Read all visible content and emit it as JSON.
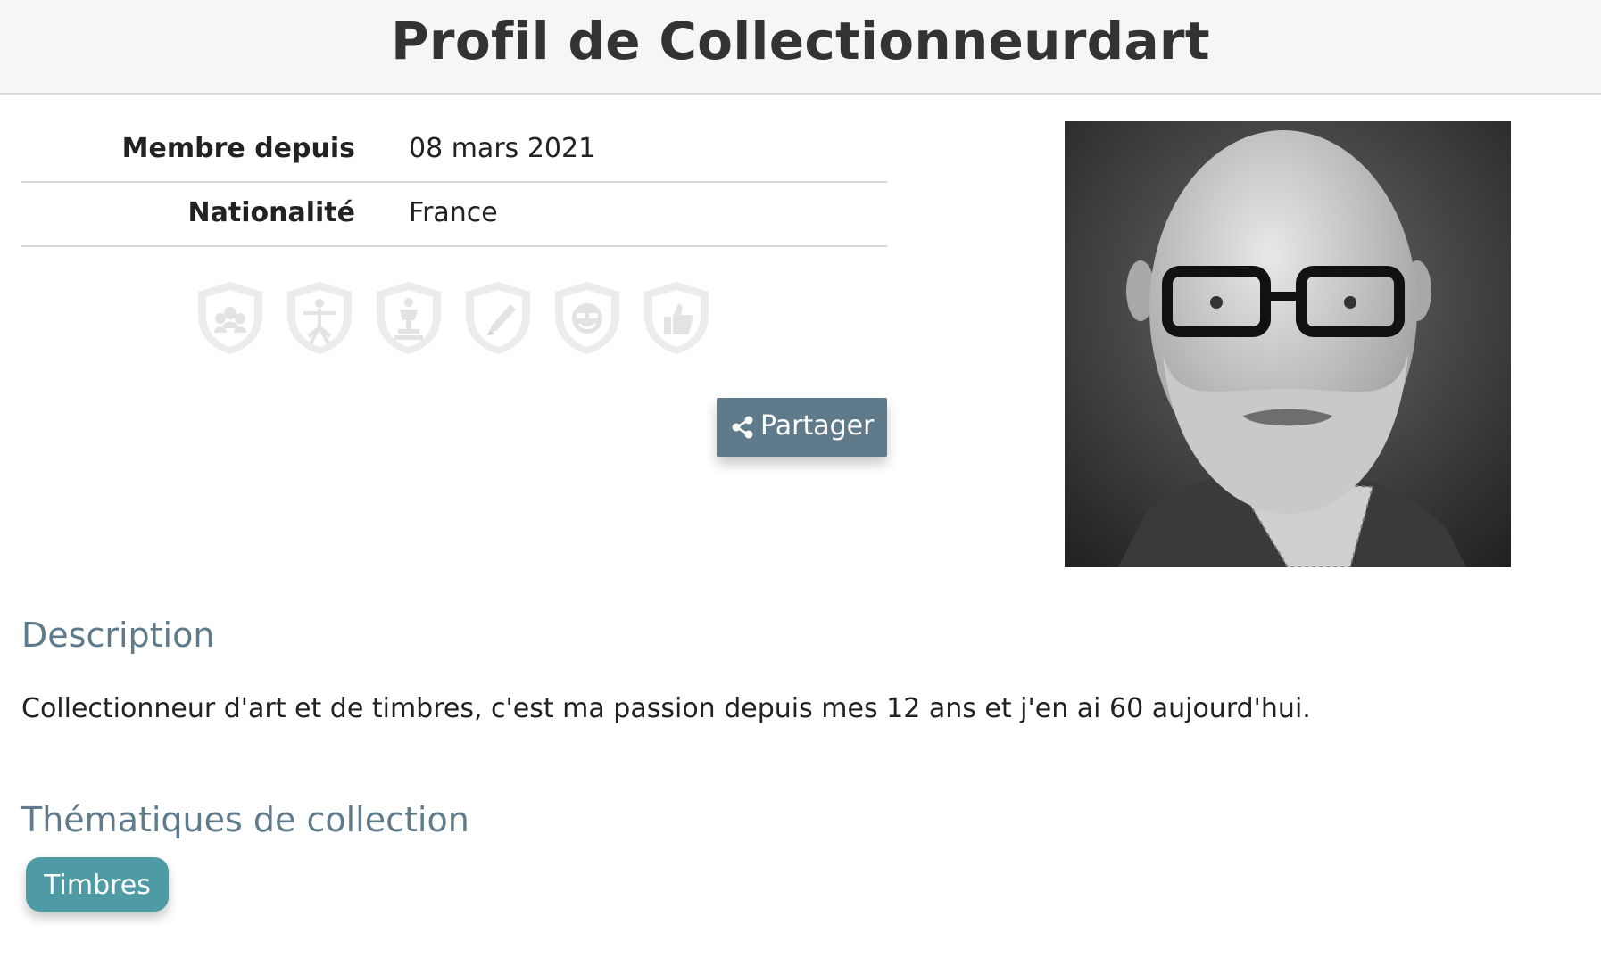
{
  "header": {
    "title": "Profil de Collectionneurdart"
  },
  "info": {
    "rows": [
      {
        "label": "Membre depuis",
        "value": "08 mars 2021"
      },
      {
        "label": "Nationalité",
        "value": "France"
      }
    ]
  },
  "badges": [
    "community-badge-icon",
    "vitruvian-man-badge-icon",
    "trophy-badge-icon",
    "pen-badge-icon",
    "smiley-badge-icon",
    "thumbs-up-badge-icon"
  ],
  "share": {
    "label": "Partager",
    "icon": "share-icon"
  },
  "description": {
    "title": "Description",
    "text": "Collectionneur d'art et de timbres, c'est ma passion depuis mes 12 ans et j'en ai 60 aujourd'hui."
  },
  "themes": {
    "title": "Thématiques de collection",
    "tags": [
      "Timbres"
    ]
  },
  "colors": {
    "accent": "#5e7a8b",
    "tag": "#4e9ba5",
    "badge": "#e6e6e6",
    "header_bg": "#f6f6f6"
  }
}
